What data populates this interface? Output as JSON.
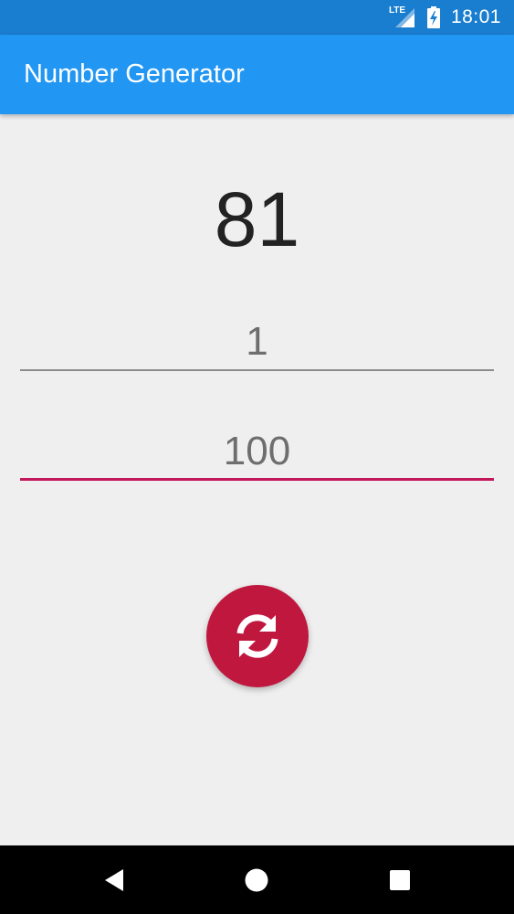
{
  "status_bar": {
    "network_label": "LTE",
    "time": "18:01"
  },
  "app_bar": {
    "title": "Number Generator"
  },
  "result": {
    "value": "81"
  },
  "inputs": {
    "min_value": "1",
    "max_value": "100"
  },
  "fab": {
    "icon": "refresh-icon",
    "color": "#c0173f"
  },
  "colors": {
    "status_bar": "#1a7ed0",
    "app_bar": "#2196f3",
    "accent": "#c2185b",
    "background": "#f0efef"
  },
  "nav_bar": {
    "icons": [
      "back-icon",
      "home-icon",
      "recents-icon"
    ]
  }
}
